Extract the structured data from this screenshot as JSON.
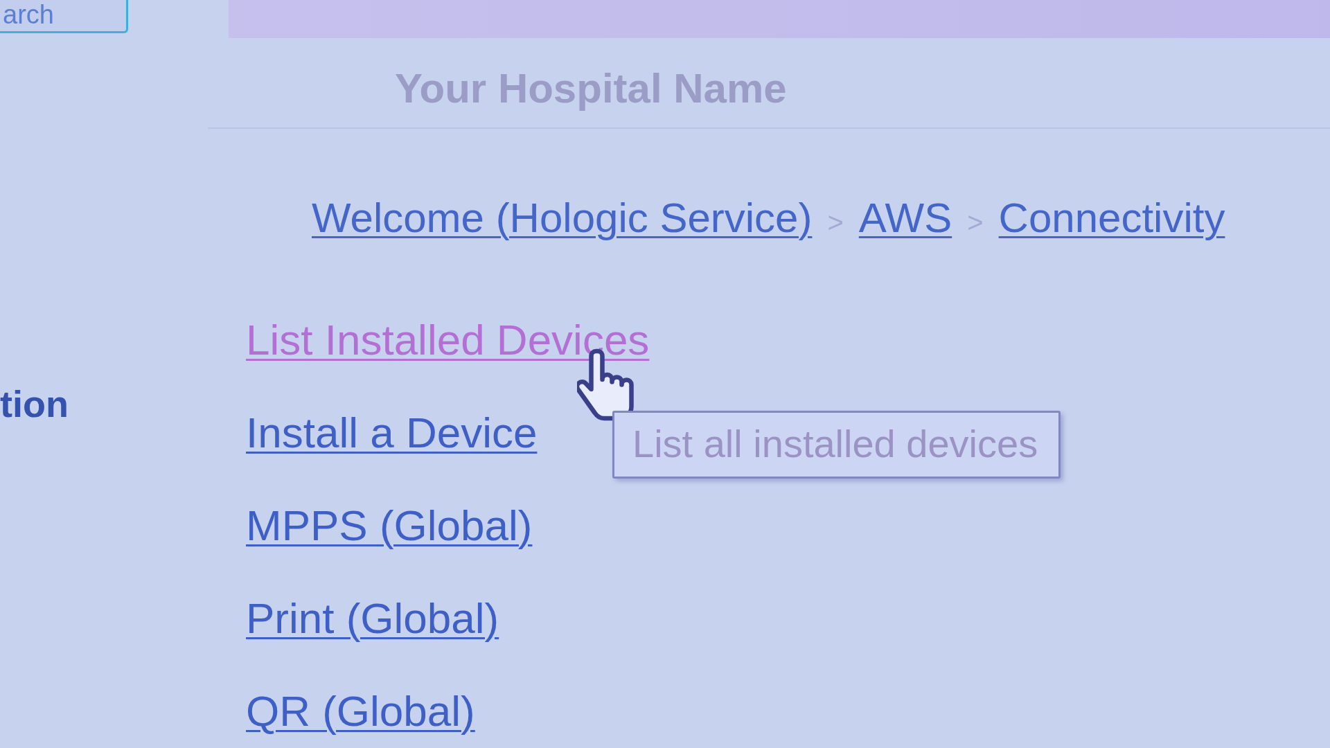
{
  "search_button": {
    "label": "arch"
  },
  "sidebar": {
    "heading": "tion"
  },
  "header": {
    "title": "Your Hospital Name"
  },
  "breadcrumb": [
    {
      "label": "Welcome (Hologic Service)"
    },
    {
      "separator": ">",
      "label": "AWS"
    },
    {
      "separator": ">",
      "label": "Connectivity"
    }
  ],
  "links": [
    {
      "label": "List Installed Devices",
      "visited": true
    },
    {
      "label": "Install a Device",
      "visited": false
    },
    {
      "label": "MPPS (Global)",
      "visited": false
    },
    {
      "label": "Print (Global)",
      "visited": false
    },
    {
      "label": "QR (Global)",
      "visited": false
    }
  ],
  "tooltip": {
    "text": "List all installed devices"
  }
}
